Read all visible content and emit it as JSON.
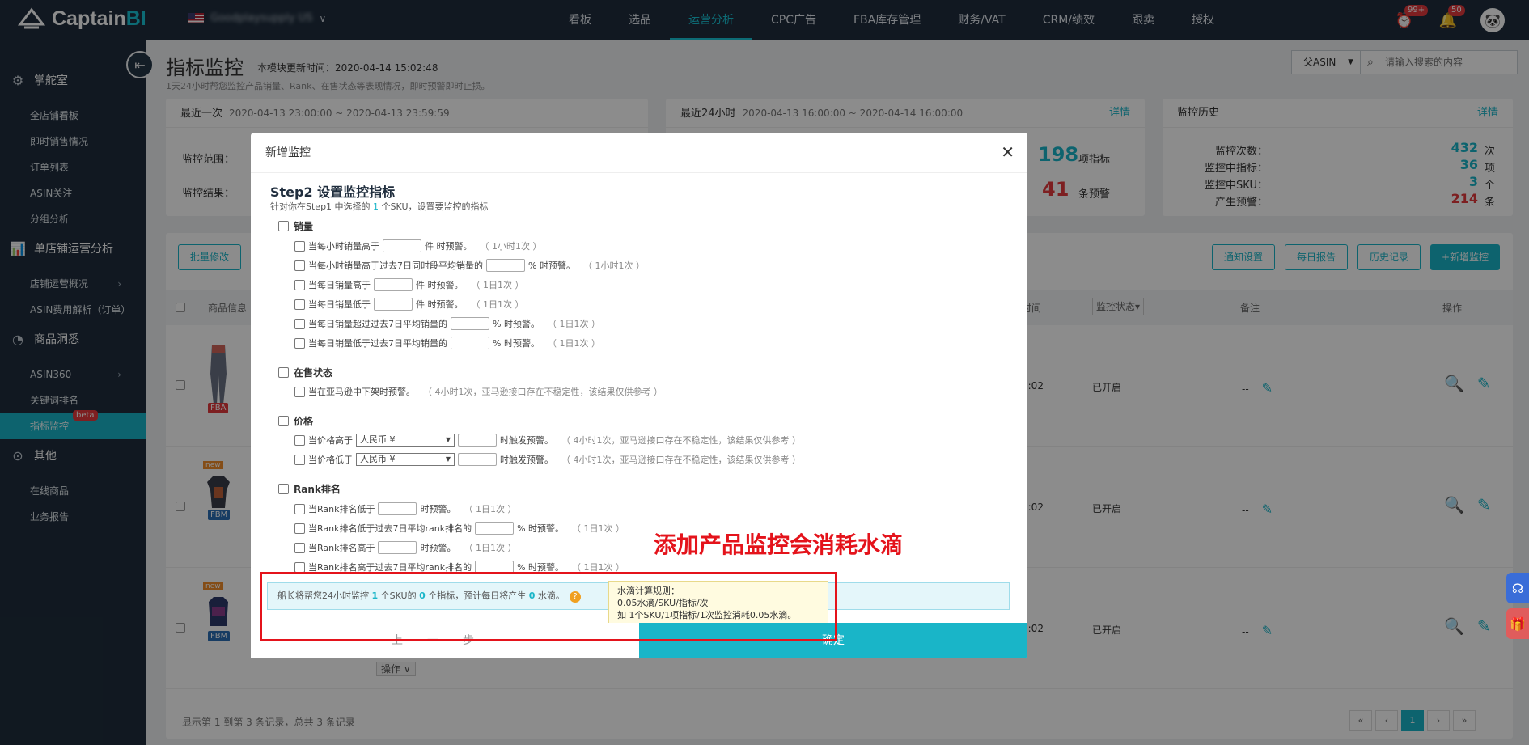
{
  "app": {
    "logo_text": "Captain",
    "logo_bi": "BI"
  },
  "store": {
    "name": "Goodplaysupply US"
  },
  "nav": [
    {
      "label": "看板"
    },
    {
      "label": "选品"
    },
    {
      "label": "运营分析"
    },
    {
      "label": "CPC广告"
    },
    {
      "label": "FBA库存管理"
    },
    {
      "label": "财务/VAT"
    },
    {
      "label": "CRM/绩效"
    },
    {
      "label": "跟卖"
    },
    {
      "label": "授权"
    }
  ],
  "badges": {
    "alerts": "99+",
    "notifications": "50"
  },
  "sidebar": {
    "sec1": "掌舵室",
    "sec1_items": [
      "全店铺看板",
      "即时销售情况",
      "订单列表",
      "ASIN关注",
      "分组分析"
    ],
    "sec2": "单店铺运营分析",
    "sec2_items": [
      "店铺运营概况",
      "ASIN费用解析（订单）"
    ],
    "sec3": "商品洞悉",
    "sec3_items": [
      "ASIN360",
      "关键词排名",
      "指标监控"
    ],
    "beta": "beta",
    "sec4": "其他",
    "sec4_items": [
      "在线商品",
      "业务报告"
    ]
  },
  "header": {
    "title": "指标监控",
    "update_time": "本模块更新时间：2020-04-14 15:02:48",
    "subtitle": "1天24小时帮您监控产品销量、Rank、在售状态等表现情况，即时预警即时止损。",
    "search_type": "父ASIN",
    "search_placeholder": "请输入搜索的内容"
  },
  "cards": {
    "recent": {
      "title": "最近一次",
      "range": "2020-04-13 23:00:00 ~ 2020-04-13 23:59:59",
      "scope_label": "监控范围：",
      "result_label": "监控结果："
    },
    "last24": {
      "title": "最近24小时",
      "range": "2020-04-13 16:00:00 ~ 2020-04-14 16:00:00",
      "detail": "详情",
      "num1": "198",
      "unit1": "项指标",
      "num2": "41",
      "unit2": "条预警"
    },
    "history": {
      "title": "监控历史",
      "detail": "详情",
      "rows": [
        {
          "k": "监控次数：",
          "v": "432",
          "u": "次"
        },
        {
          "k": "监控中指标：",
          "v": "36",
          "u": "项"
        },
        {
          "k": "监控中SKU：",
          "v": "3",
          "u": "个"
        },
        {
          "k": "产生预警：",
          "v": "214",
          "u": "条"
        }
      ]
    }
  },
  "toolbar": {
    "batch": "批量修改",
    "notify": "通知设置",
    "daily": "每日报告",
    "history": "历史记录",
    "add": "+新增监控"
  },
  "table": {
    "headers": {
      "product": "商品信息",
      "time": "时间",
      "status": "监控状态▾",
      "remark": "备注",
      "op": "操作"
    },
    "rows": [
      {
        "tag": "FBA",
        "time": "5:02",
        "status": "已开启",
        "remark": "--"
      },
      {
        "tag": "FBM",
        "time": "5:02",
        "status": "已开启",
        "remark": "--",
        "new": "new"
      },
      {
        "tag": "FBM",
        "time": "5:02",
        "status": "已开启",
        "remark": "--",
        "new": "new"
      }
    ],
    "op_dropdown": "操作 ∨",
    "records": "显示第 1 到第 3 条记录，总共 3 条记录",
    "pager": [
      "«",
      "‹",
      "1",
      "›",
      "»"
    ]
  },
  "modal": {
    "title": "新增监控",
    "step_title": "Step2 设置监控指标",
    "step_desc_pre": "针对你在Step1 中选择的 ",
    "step_desc_num": "1",
    "step_desc_post": " 个SKU，设置要监控的指标",
    "groups": {
      "sales": "销量",
      "sales_opts": [
        {
          "pre": "当每小时销量高于",
          "post": "件 时预警。",
          "note": "（ 1小时1次 ）"
        },
        {
          "pre": "当每小时销量高于过去7日同时段平均销量的",
          "post": "% 时预警。",
          "note": "（ 1小时1次 ）"
        },
        {
          "pre": "当每日销量高于",
          "post": "件 时预警。",
          "note": "（ 1日1次 ）"
        },
        {
          "pre": "当每日销量低于",
          "post": "件 时预警。",
          "note": "（ 1日1次 ）"
        },
        {
          "pre": "当每日销量超过过去7日平均销量的",
          "post": "% 时预警。",
          "note": "（ 1日1次 ）"
        },
        {
          "pre": "当每日销量低于过去7日平均销量的",
          "post": "% 时预警。",
          "note": "（ 1日1次 ）"
        }
      ],
      "onsale": "在售状态",
      "onsale_opt": "当在亚马逊中下架时预警。",
      "onsale_note": "（ 4小时1次，亚马逊接口存在不稳定性，该结果仅供参考 ）",
      "price": "价格",
      "price_opts": [
        {
          "pre": "当价格高于",
          "currency": "人民币 ¥",
          "post": "时触发预警。",
          "note": "（ 4小时1次，亚马逊接口存在不稳定性，该结果仅供参考 ）"
        },
        {
          "pre": "当价格低于",
          "currency": "人民币 ¥",
          "post": "时触发预警。",
          "note": "（ 4小时1次，亚马逊接口存在不稳定性，该结果仅供参考 ）"
        }
      ],
      "rank": "Rank排名",
      "rank_opts": [
        {
          "pre": "当Rank排名低于",
          "post": "时预警。",
          "note": "（ 1日1次 ）"
        },
        {
          "pre": "当Rank排名低于过去7日平均rank排名的",
          "post": "% 时预警。",
          "note": "（ 1日1次 ）"
        },
        {
          "pre": "当Rank排名高于",
          "post": "时预警。",
          "note": "（ 1日1次 ）"
        },
        {
          "pre": "当Rank排名高于过去7日平均rank排名的",
          "post": "% 时预警。",
          "note": "（ 1日1次 ）"
        }
      ]
    },
    "info_pre": "船长将帮您24小时监控 ",
    "info_sku": "1",
    "info_mid1": " 个SKU的 ",
    "info_idx": "0",
    "info_mid2": " 个指标，预计每日将产生 ",
    "info_drops": "0",
    "info_post": " 水滴。",
    "tooltip": [
      "水滴计算规则：",
      "0.05水滴/SKU/指标/次",
      "如 1个SKU/1项指标/1次监控消耗0.05水滴。"
    ],
    "prev": "上一步",
    "ok": "确定"
  },
  "annotation": "添加产品监控会消耗水滴",
  "colors": {
    "accent": "#19b5c8",
    "nav_bg": "#1f2d3d",
    "annotation": "#e4131b"
  }
}
